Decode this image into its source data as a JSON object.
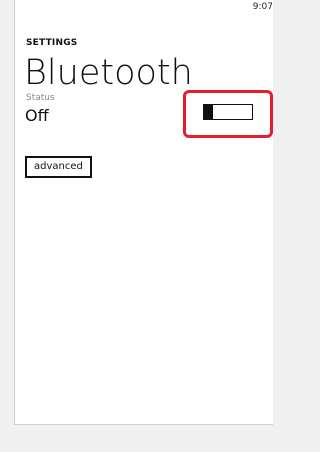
{
  "status_bar": {
    "time": "9:07"
  },
  "header": {
    "section": "SETTINGS",
    "title": "Bluetooth"
  },
  "bluetooth": {
    "status_label": "Status",
    "status_value": "Off",
    "toggle_on": false
  },
  "buttons": {
    "advanced_label": "advanced"
  },
  "colors": {
    "highlight": "#e41e2b",
    "foreground": "#111111",
    "muted": "#8a8a8a"
  }
}
